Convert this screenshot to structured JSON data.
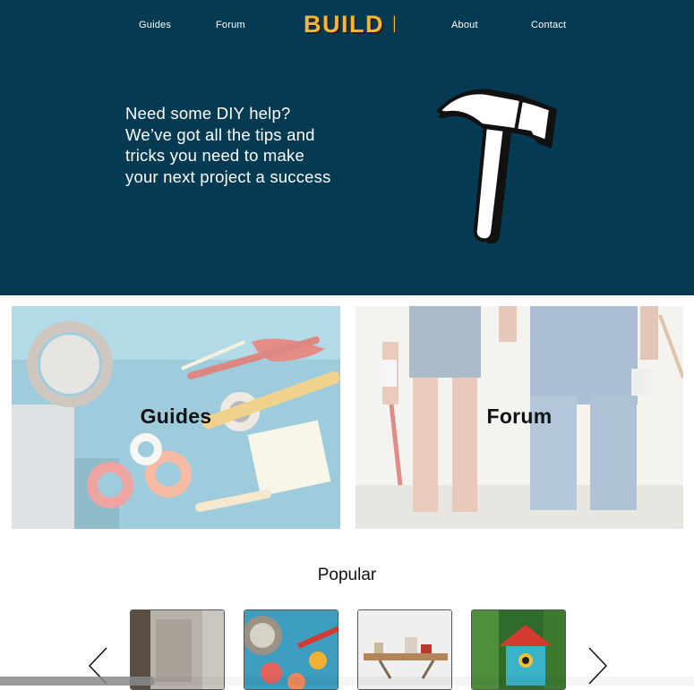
{
  "nav": {
    "guides": "Guides",
    "forum": "Forum",
    "logo": "BUILD IT",
    "about": "About",
    "contact": "Contact"
  },
  "hero": {
    "text": "Need some DIY help? We’ve got all the tips and tricks you need to make your next project a success",
    "icon": "hammer-icon",
    "background": "#053b52"
  },
  "cards": [
    {
      "label": "Guides"
    },
    {
      "label": "Forum"
    }
  ],
  "popular": {
    "title": "Popular"
  },
  "colors": {
    "logo": "#f5b731",
    "logo_shadow": "#2b1d0a"
  }
}
